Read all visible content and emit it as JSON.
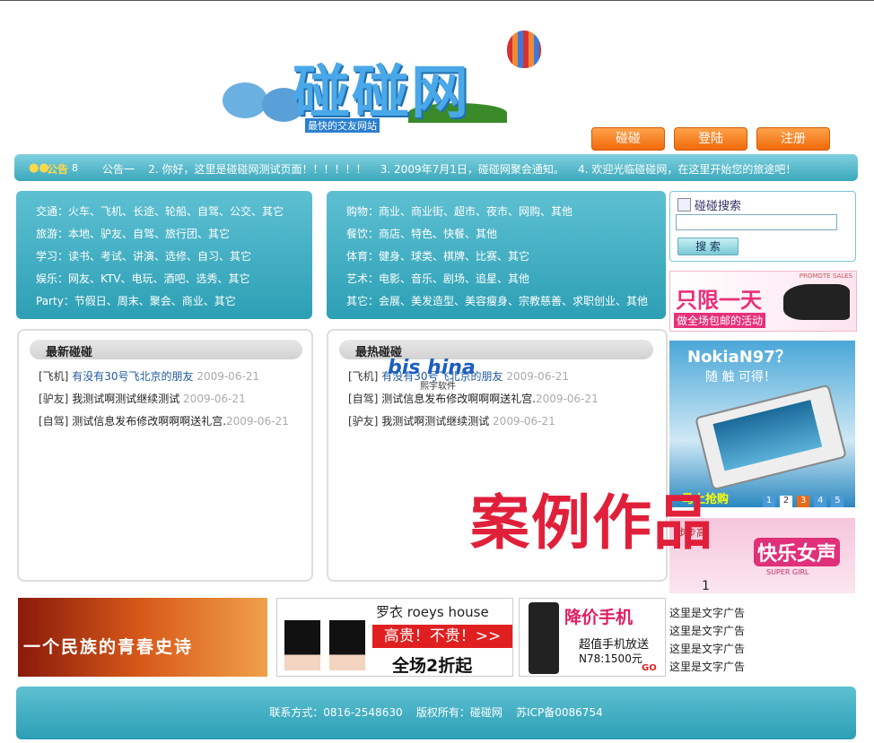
{
  "header": {
    "logo_text": "碰碰网",
    "slogan": "最快的交友网站",
    "buttons": [
      "碰碰",
      "登陆",
      "注册"
    ]
  },
  "notice": {
    "label": "公告",
    "label_suffix": "8",
    "text": "公告一    2. 你好，这里是碰碰网测试页面！！！！！！    3. 2009年7月1日，碰碰网聚会通知。    4. 欢迎光临碰碰网，在这里开始您的旅途吧！"
  },
  "categories_left": [
    {
      "name": "交通：",
      "items": "火车、飞机、长途、轮船、自驾、公交、其它"
    },
    {
      "name": "旅游：",
      "items": "本地、驴友、自驾、旅行团、其它"
    },
    {
      "name": "学习：",
      "items": "读书、考试、讲演、选修、自习、其它"
    },
    {
      "name": "娱乐：",
      "items": "网友、KTV、电玩、酒吧、选秀、其它"
    },
    {
      "name": "Party：",
      "items": "节假日、周末、聚会、商业、其它"
    }
  ],
  "categories_right": [
    {
      "name": "购物：",
      "items": "商业、商业街、超市、夜市、网购、其他"
    },
    {
      "name": "餐饮：",
      "items": "商店、特色、快餐、其他"
    },
    {
      "name": "体育：",
      "items": "健身、球类、棋牌、比赛、其它"
    },
    {
      "name": "艺术：",
      "items": "电影、音乐、剧场、追星、其他"
    },
    {
      "name": "其它：",
      "items": "会展、美发造型、美容瘦身、宗教慈善、求职创业、其他"
    }
  ],
  "search": {
    "title": "碰碰搜索",
    "button": "搜 索",
    "value": ""
  },
  "latest": {
    "title": "最新碰碰",
    "items": [
      {
        "tag": "[飞机]",
        "title": "有没有30号飞北京的朋友",
        "date": "2009-06-21"
      },
      {
        "tag": "[驴友]",
        "title": "我测试啊测试继续测试",
        "date": "2009-06-21"
      },
      {
        "tag": "[自驾]",
        "title": "测试信息发布修改啊啊啊送礼宫.",
        "date": "2009-06-21"
      }
    ]
  },
  "hottest": {
    "title": "最热碰碰",
    "items": [
      {
        "tag": "[飞机]",
        "title": "有没有30号飞北京的朋友",
        "date": "2009-06-21"
      },
      {
        "tag": "[自驾]",
        "title": "测试信息发布修改啊啊啊送礼宫.",
        "date": "2009-06-21"
      },
      {
        "tag": "[驴友]",
        "title": "我测试啊测试继续测试",
        "date": "2009-06-21"
      }
    ]
  },
  "ads": {
    "sale": {
      "top": "PROMOTE SALES",
      "big": "只限一天",
      "sub": "做全场包邮的活动"
    },
    "nokia": {
      "title": "NokiaN97？",
      "sub": "随 触 可得！",
      "cta": "马上抢购",
      "pages": [
        "1",
        "2",
        "3",
        "4",
        "5"
      ]
    },
    "girl": {
      "brand": "步步高",
      "title": "快乐女声",
      "sub": "SUPER GIRL",
      "number": "1"
    },
    "banner1": "一个民族的青春史诗",
    "banner2": {
      "brand": "罗衣 roeys house",
      "line1": "高贵！不贵！>>",
      "line2": "全场2折起"
    },
    "banner3": {
      "title": "降价手机",
      "line1": "超值手机放送",
      "line2": "N78:1500元",
      "go": "GO"
    },
    "text_ads": [
      "这里是文字广告",
      "这里是文字广告",
      "这里是文字广告",
      "这里是文字广告"
    ]
  },
  "footer": {
    "text": "联系方式：0816-2548630    版权所有：碰碰网    苏ICP备0086754"
  },
  "watermark": {
    "main": "案例作品",
    "brand": "bis hina",
    "brand_sub": "熙宇软件"
  },
  "colors": {
    "teal": "#3aa8bc",
    "orange": "#f07a1a",
    "watermark_red": "#e0203a"
  }
}
